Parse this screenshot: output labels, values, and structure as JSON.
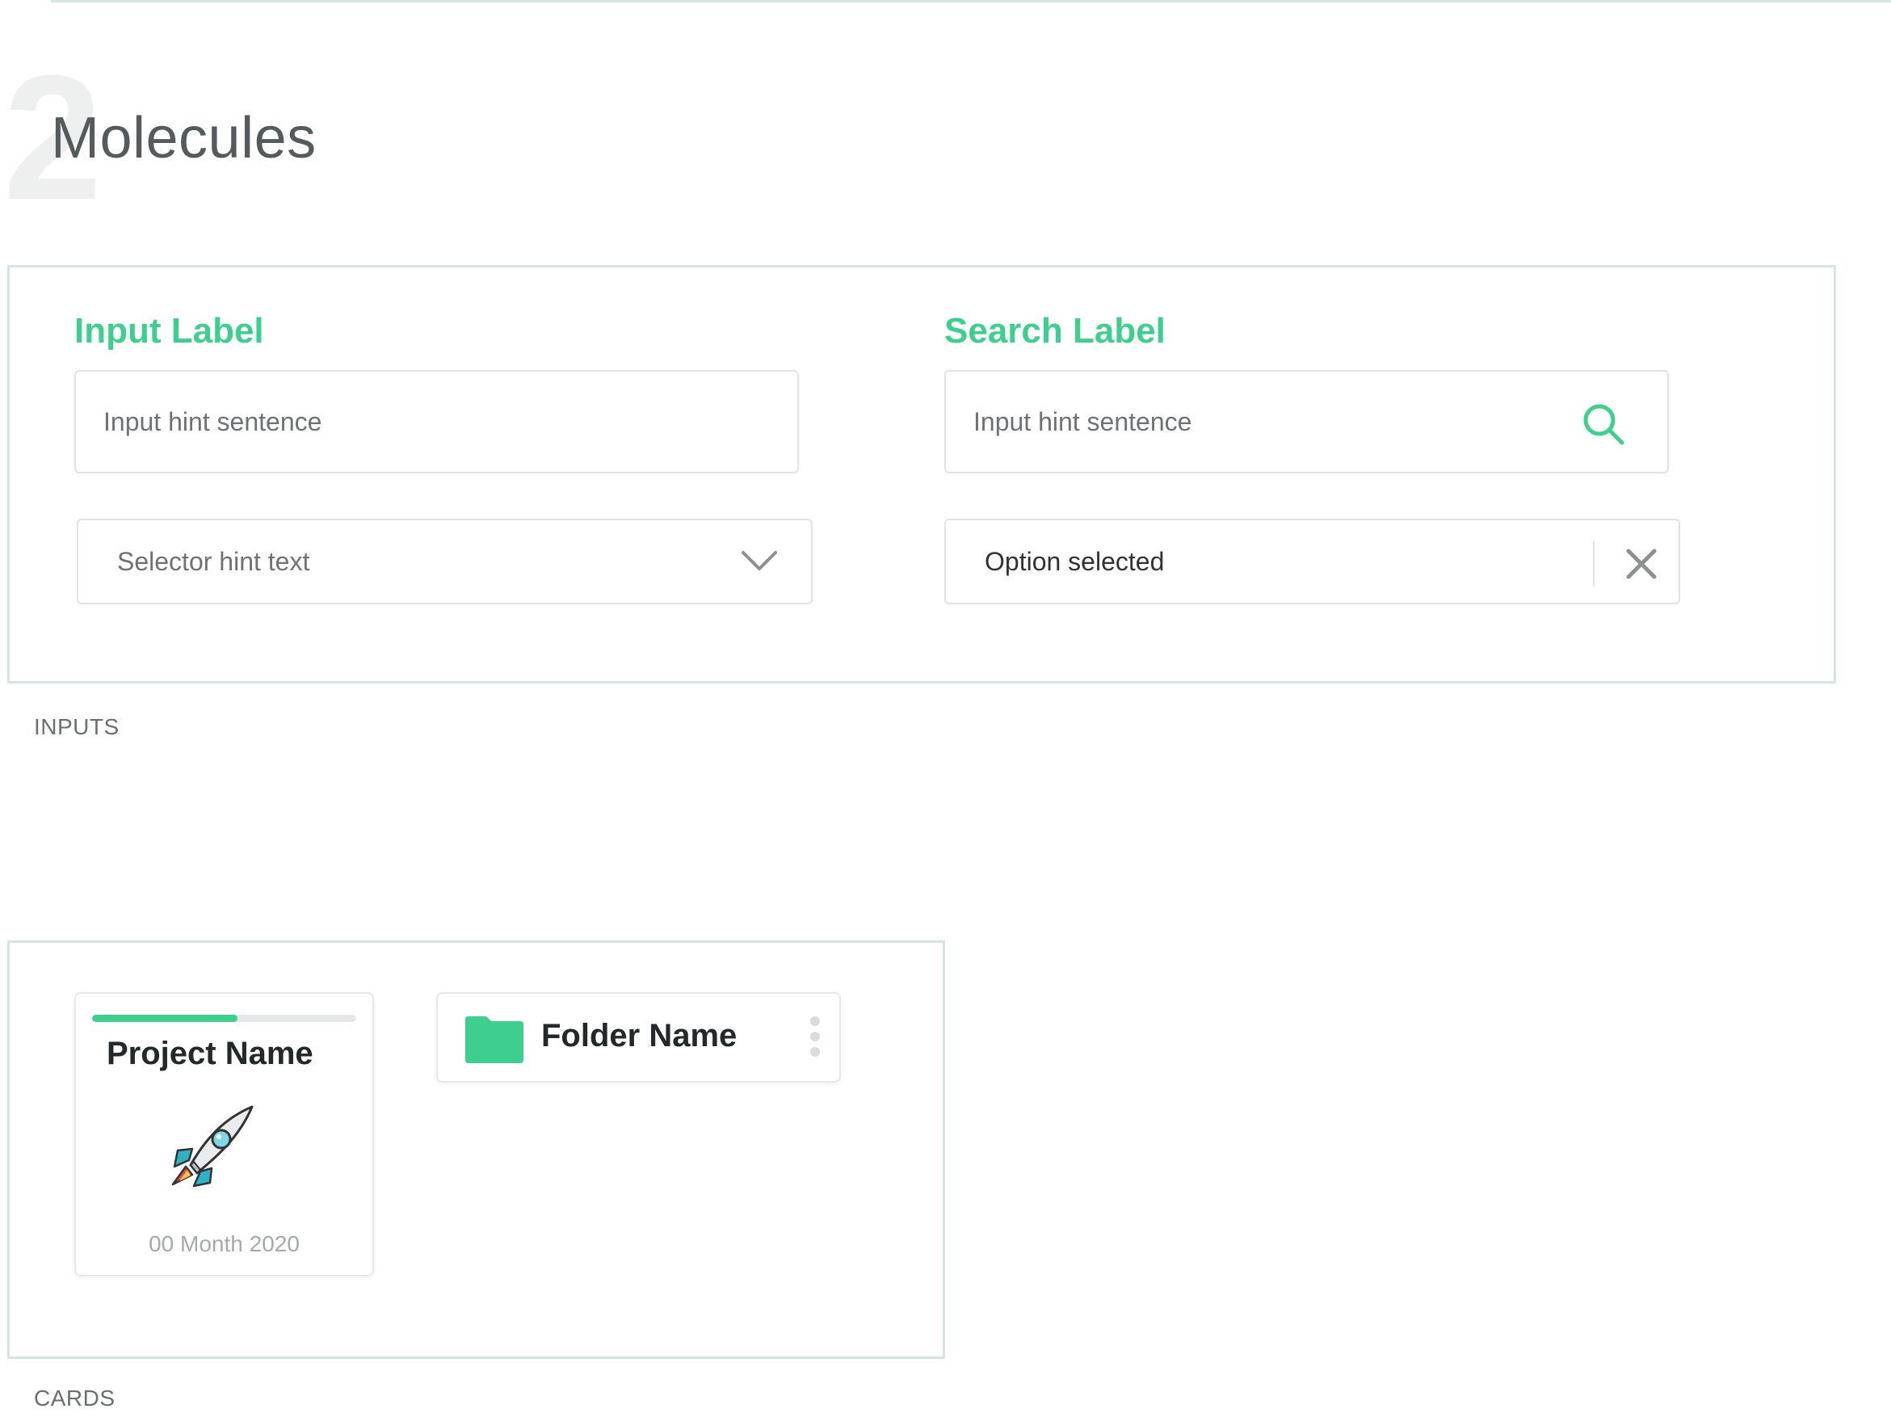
{
  "header": {
    "section_number": "2",
    "section_title": "Molecules"
  },
  "inputs_panel": {
    "caption": "INPUTS",
    "text_input": {
      "label": "Input Label",
      "placeholder": "Input hint sentence"
    },
    "search_input": {
      "label": "Search Label",
      "placeholder": "Input hint sentence",
      "icon": "search-icon"
    },
    "selector": {
      "placeholder": "Selector hint text",
      "icon": "chevron-down-icon"
    },
    "selected_option": {
      "value": "Option selected",
      "icon": "close-icon"
    }
  },
  "cards_panel": {
    "caption": "CARDS",
    "project_card": {
      "name": "Project Name",
      "date": "00 Month 2020",
      "progress": 0.55,
      "icon": "rocket-icon"
    },
    "folder_card": {
      "name": "Folder Name",
      "icon": "folder-icon",
      "menu_icon": "kebab-menu-icon"
    }
  },
  "colors": {
    "accent": "#3ecf8e",
    "panel_border": "#d3e6e0",
    "text_dark": "#23282a",
    "hint_text": "#6c7275"
  }
}
